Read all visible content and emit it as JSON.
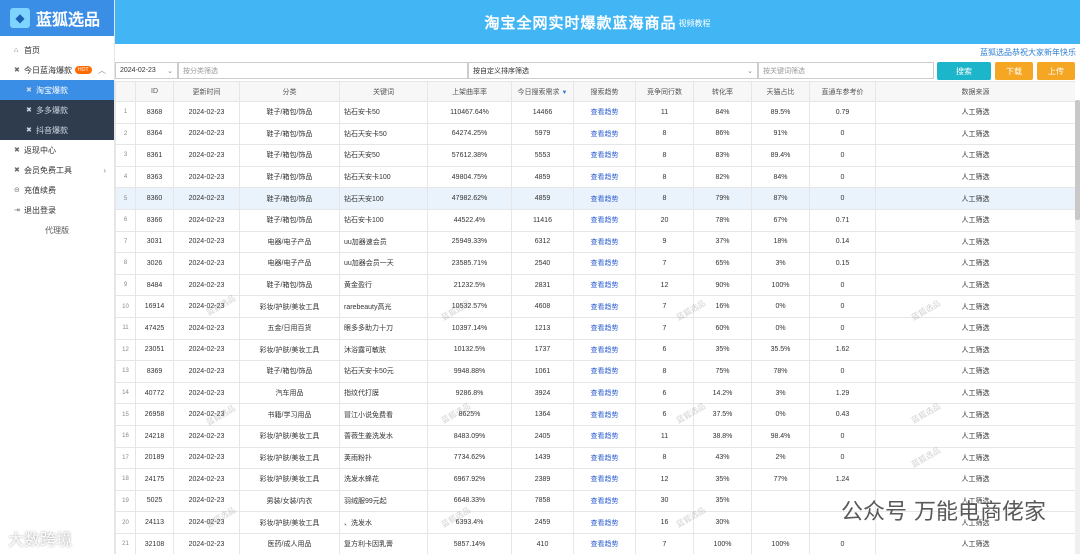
{
  "brand": {
    "name": "蓝狐选品",
    "logo_icon": "fox-logo-icon"
  },
  "sidebar": {
    "items": [
      {
        "label": "首页",
        "icon": "home-icon"
      },
      {
        "label": "今日蓝海爆款",
        "icon": "close-icon",
        "badge": "HOT",
        "expanded": true
      },
      {
        "label": "淘宝爆款",
        "icon": "close-icon",
        "active": true,
        "sub": true
      },
      {
        "label": "多多爆款",
        "icon": "close-icon",
        "sub": true
      },
      {
        "label": "抖音爆款",
        "icon": "close-icon",
        "sub": true
      },
      {
        "label": "返现中心",
        "icon": "close-icon"
      },
      {
        "label": "会员免费工具",
        "icon": "close-icon"
      },
      {
        "label": "充值续费",
        "icon": "coin-icon"
      },
      {
        "label": "退出登录",
        "icon": "logout-icon"
      },
      {
        "label": "代理版"
      }
    ]
  },
  "header": {
    "title": "淘宝全网实时爆款蓝海商品",
    "link": "视频教程"
  },
  "notice": "蓝狐选品恭祝大家新年快乐",
  "toolbar": {
    "date": "2024-02-23",
    "category_placeholder": "按分类筛选",
    "sort_value": "按自定义排序筛选",
    "keyword_placeholder": "按关键词筛选",
    "search_label": "搜索",
    "download_label": "下载",
    "upload_label": "上传"
  },
  "table": {
    "headers": [
      "",
      "ID",
      "更新时间",
      "分类",
      "关键词",
      "上架曲率率",
      "今日搜索需求",
      "搜索趋势",
      "竞争同行数",
      "转化率",
      "天猫占比",
      "直通车参考价",
      "数据来源"
    ],
    "rows": [
      [
        "1",
        "8368",
        "2024-02-23",
        "鞋子/箱包/饰品",
        "钻石安卡50",
        "110467.64%",
        "14466",
        "查看趋势",
        "11",
        "84%",
        "89.5%",
        "0.79",
        "人工筛选"
      ],
      [
        "2",
        "8364",
        "2024-02-23",
        "鞋子/箱包/饰品",
        "钻石天安卡50",
        "64274.25%",
        "5979",
        "查看趋势",
        "8",
        "86%",
        "91%",
        "0",
        "人工筛选"
      ],
      [
        "3",
        "8361",
        "2024-02-23",
        "鞋子/箱包/饰品",
        "钻石天安50",
        "57612.38%",
        "5553",
        "查看趋势",
        "8",
        "83%",
        "89.4%",
        "0",
        "人工筛选"
      ],
      [
        "4",
        "8363",
        "2024-02-23",
        "鞋子/箱包/饰品",
        "钻石天安卡100",
        "49804.75%",
        "4859",
        "查看趋势",
        "8",
        "82%",
        "84%",
        "0",
        "人工筛选"
      ],
      [
        "5",
        "8360",
        "2024-02-23",
        "鞋子/箱包/饰品",
        "钻石天安100",
        "47982.62%",
        "4859",
        "查看趋势",
        "8",
        "79%",
        "87%",
        "0",
        "人工筛选"
      ],
      [
        "6",
        "8366",
        "2024-02-23",
        "鞋子/箱包/饰品",
        "钻石安卡100",
        "44522.4%",
        "11416",
        "查看趋势",
        "20",
        "78%",
        "67%",
        "0.71",
        "人工筛选"
      ],
      [
        "7",
        "3031",
        "2024-02-23",
        "电器/电子产品",
        "uu加器速会员",
        "25949.33%",
        "6312",
        "查看趋势",
        "9",
        "37%",
        "18%",
        "0.14",
        "人工筛选"
      ],
      [
        "8",
        "3026",
        "2024-02-23",
        "电器/电子产品",
        "uu加器会员一天",
        "23585.71%",
        "2540",
        "查看趋势",
        "7",
        "65%",
        "3%",
        "0.15",
        "人工筛选"
      ],
      [
        "9",
        "8484",
        "2024-02-23",
        "鞋子/箱包/饰品",
        "黄金盈行",
        "21232.5%",
        "2831",
        "查看趋势",
        "12",
        "90%",
        "100%",
        "0",
        "人工筛选"
      ],
      [
        "10",
        "16914",
        "2024-02-23",
        "彩妆/护肤/美妆工具",
        "rarebeauty高光",
        "10532.57%",
        "4608",
        "查看趋势",
        "7",
        "16%",
        "0%",
        "0",
        "人工筛选"
      ],
      [
        "11",
        "47425",
        "2024-02-23",
        "五金/日用百货",
        "眼多多助力十刀",
        "10397.14%",
        "1213",
        "查看趋势",
        "7",
        "60%",
        "0%",
        "0",
        "人工筛选"
      ],
      [
        "12",
        "23051",
        "2024-02-23",
        "彩妆/护肤/美妆工具",
        "沐浴露可敏肤",
        "10132.5%",
        "1737",
        "查看趋势",
        "6",
        "35%",
        "35.5%",
        "1.62",
        "人工筛选"
      ],
      [
        "13",
        "8369",
        "2024-02-23",
        "鞋子/箱包/饰品",
        "钻石天安卡50元",
        "9948.88%",
        "1061",
        "查看趋势",
        "8",
        "75%",
        "78%",
        "0",
        "人工筛选"
      ],
      [
        "14",
        "40772",
        "2024-02-23",
        "汽车用品",
        "指纹代打膜",
        "9286.8%",
        "3924",
        "查看趋势",
        "6",
        "14.2%",
        "3%",
        "1.29",
        "人工筛选"
      ],
      [
        "15",
        "26958",
        "2024-02-23",
        "书籍/学习用品",
        "冒江小说免费看",
        "8625%",
        "1364",
        "查看趋势",
        "6",
        "37.5%",
        "0%",
        "0.43",
        "人工筛选"
      ],
      [
        "16",
        "24218",
        "2024-02-23",
        "彩妆/护肤/美妆工具",
        "蔷薇生姜洗发水",
        "8483.09%",
        "2405",
        "查看趋势",
        "11",
        "38.8%",
        "98.4%",
        "0",
        "人工筛选"
      ],
      [
        "17",
        "20189",
        "2024-02-23",
        "彩妆/护肤/美妆工具",
        "荚雨粉扑",
        "7734.62%",
        "1439",
        "查看趋势",
        "8",
        "43%",
        "2%",
        "0",
        "人工筛选"
      ],
      [
        "18",
        "24175",
        "2024-02-23",
        "彩妆/护肤/美妆工具",
        "洗发水蜂花",
        "6967.92%",
        "2389",
        "查看趋势",
        "12",
        "35%",
        "77%",
        "1.24",
        "人工筛选"
      ],
      [
        "19",
        "5025",
        "2024-02-23",
        "男装/女装/内衣",
        "羽绒服99元起",
        "6648.33%",
        "7858",
        "查看趋势",
        "30",
        "35%",
        "",
        "",
        "人工筛选"
      ],
      [
        "20",
        "24113",
        "2024-02-23",
        "彩妆/护肤/美妆工具",
        "、洗发水",
        "6393.4%",
        "2459",
        "查看趋势",
        "16",
        "30%",
        "",
        "",
        "人工筛选"
      ],
      [
        "21",
        "32108",
        "2024-02-23",
        "医药/成人用品",
        "复方利卡因乳膏",
        "5857.14%",
        "410",
        "查看趋势",
        "7",
        "100%",
        "100%",
        "0",
        "人工筛选"
      ]
    ]
  },
  "watermarks": {
    "tile": "蓝狐选品",
    "footer_left": "大数跨境",
    "footer_right": "公众号 万能电商佬家"
  }
}
